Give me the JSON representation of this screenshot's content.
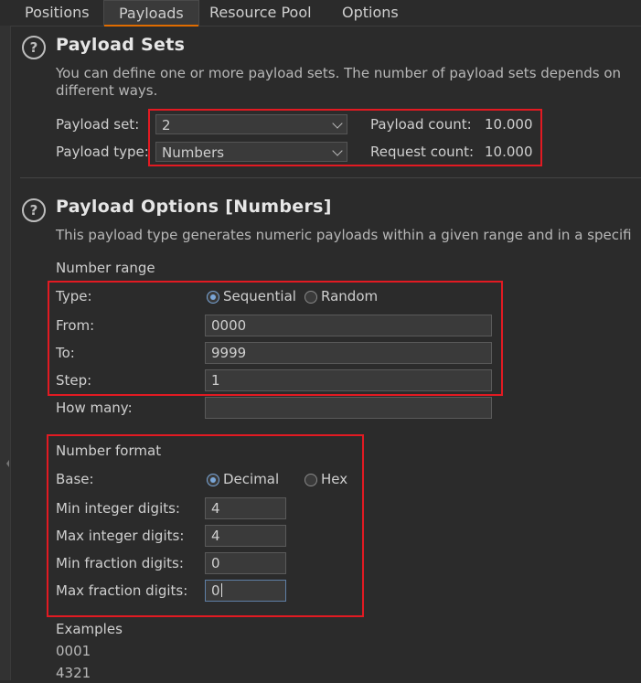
{
  "tabs": [
    {
      "label": "Positions"
    },
    {
      "label": "Payloads"
    },
    {
      "label": "Resource Pool"
    },
    {
      "label": "Options"
    }
  ],
  "payload_sets": {
    "title": "Payload Sets",
    "description_line1": "You can define one or more payload sets. The number of payload sets depends on",
    "description_line2": "different ways.",
    "set_label": "Payload set:",
    "set_value": "2",
    "type_label": "Payload type:",
    "type_value": "Numbers",
    "payload_count_label": "Payload count:",
    "payload_count_value": "10.000",
    "request_count_label": "Request count:",
    "request_count_value": "10.000"
  },
  "payload_options": {
    "title": "Payload Options [Numbers]",
    "description": "This payload type generates numeric payloads within a given range and in a specifi",
    "number_range": {
      "heading": "Number range",
      "type_label": "Type:",
      "sequential_label": "Sequential",
      "random_label": "Random",
      "selected": "Sequential",
      "from_label": "From:",
      "from_value": "0000",
      "to_label": "To:",
      "to_value": "9999",
      "step_label": "Step:",
      "step_value": "1",
      "how_many_label": "How many:",
      "how_many_value": ""
    },
    "number_format": {
      "heading": "Number format",
      "base_label": "Base:",
      "decimal_label": "Decimal",
      "hex_label": "Hex",
      "selected": "Decimal",
      "min_int_label": "Min integer digits:",
      "min_int_value": "4",
      "max_int_label": "Max integer digits:",
      "max_int_value": "4",
      "min_frac_label": "Min fraction digits:",
      "min_frac_value": "0",
      "max_frac_label": "Max fraction digits:",
      "max_frac_value": "0"
    },
    "examples": {
      "heading": "Examples",
      "values": [
        "0001",
        "4321"
      ]
    }
  },
  "colors": {
    "background": "#2b2b2b",
    "accent_tab": "#e06c00",
    "highlight_box": "#e21a22",
    "radio_selected": "#7aa6d8"
  }
}
